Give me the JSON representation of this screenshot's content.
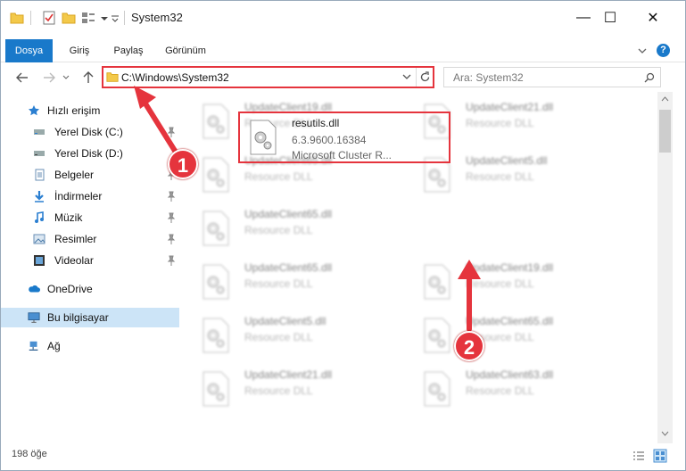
{
  "window": {
    "title": "System32",
    "controls": {
      "minimize": "—",
      "maximize": "☐",
      "close": "✕"
    }
  },
  "ribbon": {
    "tabs": [
      "Dosya",
      "Giriş",
      "Paylaş",
      "Görünüm"
    ],
    "help": "?"
  },
  "address": {
    "path": "C:\\Windows\\System32",
    "search_placeholder": "Ara: System32"
  },
  "nav": {
    "quick_access": "Hızlı erişim",
    "items": [
      {
        "label": "Yerel Disk (C:)",
        "icon": "drive-icon"
      },
      {
        "label": "Yerel Disk (D:)",
        "icon": "drive-icon"
      },
      {
        "label": "Belgeler",
        "icon": "documents-icon"
      },
      {
        "label": "İndirmeler",
        "icon": "downloads-icon"
      },
      {
        "label": "Müzik",
        "icon": "music-icon"
      },
      {
        "label": "Resimler",
        "icon": "pictures-icon"
      },
      {
        "label": "Videolar",
        "icon": "videos-icon"
      }
    ],
    "onedrive": "OneDrive",
    "this_pc": "Bu bilgisayar",
    "network": "Ağ"
  },
  "files": {
    "left": [
      {
        "name": "UpdateClient19.dll",
        "desc": "Resource DLL"
      },
      {
        "name": "UpdateClient65.dll",
        "desc": "Resource DLL"
      },
      {
        "name": "UpdateClient65.dll",
        "desc": "Resource DLL"
      },
      {
        "name": "UpdateClient65.dll",
        "desc": "Resource DLL"
      },
      {
        "name": "UpdateClient5.dll",
        "desc": "Resource DLL"
      },
      {
        "name": "UpdateClient21.dll",
        "desc": "Resource DLL"
      }
    ],
    "right": [
      {
        "name": "UpdateClient21.dll",
        "desc": "Resource DLL"
      },
      {
        "name": "UpdateClient5.dll",
        "desc": "Resource DLL"
      },
      {
        "name": "UpdateClient19.dll",
        "desc": "Resource DLL"
      },
      {
        "name": "UpdateClient65.dll",
        "desc": "Resource DLL"
      },
      {
        "name": "UpdateClient63.dll",
        "desc": "Resource DLL"
      }
    ],
    "selected": {
      "name": "resutils.dll",
      "version": "6.3.9600.16384",
      "desc": "Microsoft Cluster R..."
    }
  },
  "status": {
    "count": "198 öğe"
  },
  "callouts": {
    "one": "1",
    "two": "2"
  },
  "colors": {
    "accent": "#1979ca",
    "highlight": "#e5343d"
  }
}
